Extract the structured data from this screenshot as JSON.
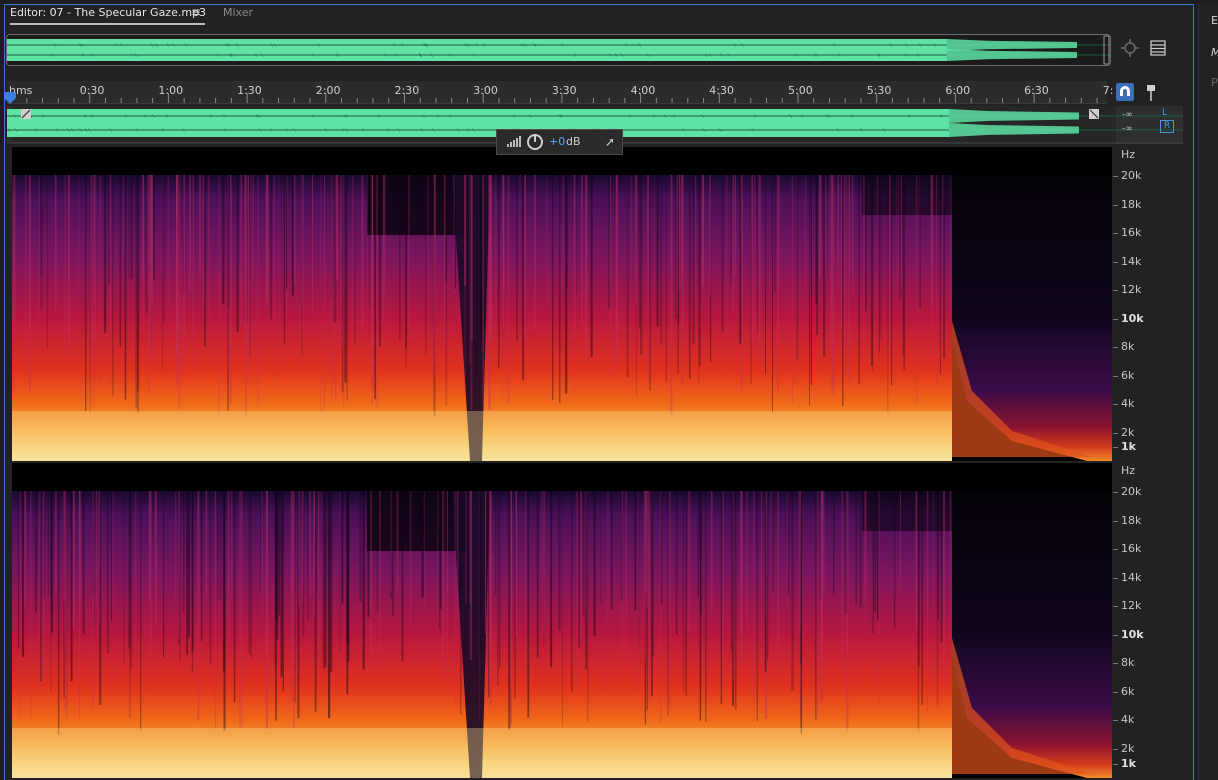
{
  "editor": {
    "tab_label": "Editor: 07 - The Specular Gaze.mp3",
    "menu_glyph": "≡",
    "mixer_label": "Mixer"
  },
  "ruler": {
    "unit": "hms",
    "ticks": [
      "0:30",
      "1:00",
      "1:30",
      "2:00",
      "2:30",
      "3:00",
      "3:30",
      "4:00",
      "4:30",
      "5:00",
      "5:30",
      "6:00",
      "6:30",
      "7:"
    ]
  },
  "channels": {
    "left_db": "-∞",
    "right_db": "-∞",
    "left_label": "L",
    "right_label": "R"
  },
  "hud": {
    "value": "+0",
    "unit": "dB"
  },
  "frequency_scale": {
    "unit": "Hz",
    "labels": [
      "20k",
      "18k",
      "16k",
      "14k",
      "12k",
      "10k",
      "8k",
      "6k",
      "4k",
      "2k",
      "1k"
    ]
  },
  "side_panel": {
    "label_1": "E",
    "label_2": "M",
    "label_3": "P"
  },
  "colors": {
    "waveform": "#5ee3a4",
    "accent": "#3b6fb8"
  }
}
